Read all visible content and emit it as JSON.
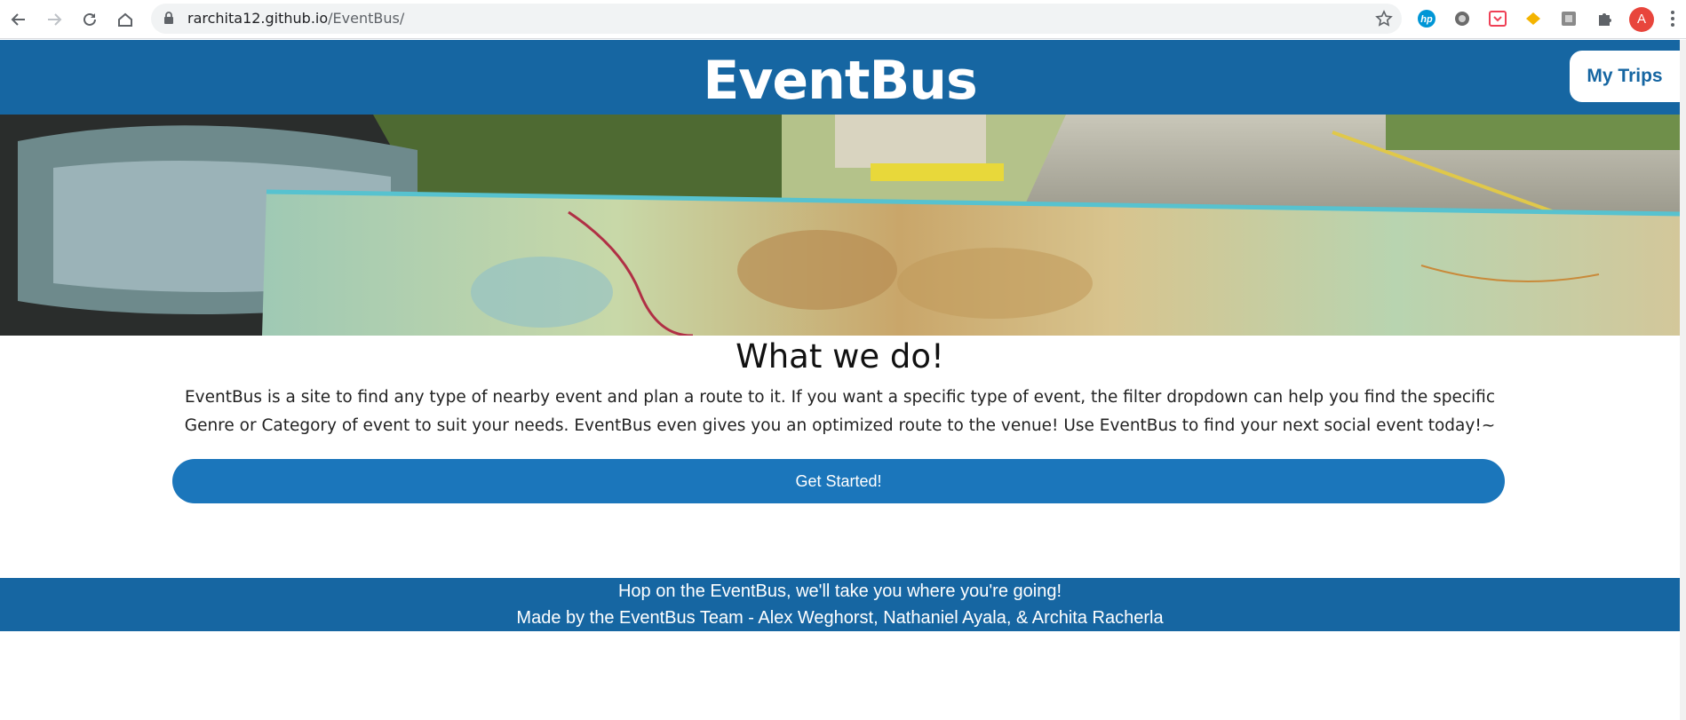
{
  "browser": {
    "url_host": "rarchita12.github.io",
    "url_path": "/EventBus/",
    "profile_initial": "A",
    "extensions": [
      "hp-icon",
      "circle-extension-icon",
      "pocket-icon",
      "diamond-extension-icon",
      "grey-extension-icon",
      "puzzle-icon"
    ]
  },
  "header": {
    "brand": "EventBus",
    "my_trips_label": "My Trips"
  },
  "main": {
    "heading": "What we do!",
    "description": "EventBus is a site to find any type of nearby event and plan a route to it. If you want a specific type of event, the filter dropdown can help you find the specific Genre or Category of event to suit your needs. EventBus even gives you an optimized route to the venue! Use EventBus to find your next social event today!~",
    "cta_label": "Get Started!"
  },
  "footer": {
    "tagline": "Hop on the EventBus, we'll take you where you're going!",
    "credits": "Made by the EventBus Team - Alex Weghorst, Nathaniel Ayala, & Archita Racherla"
  },
  "colors": {
    "header_blue": "#1666a2",
    "button_blue": "#1b76bb"
  }
}
